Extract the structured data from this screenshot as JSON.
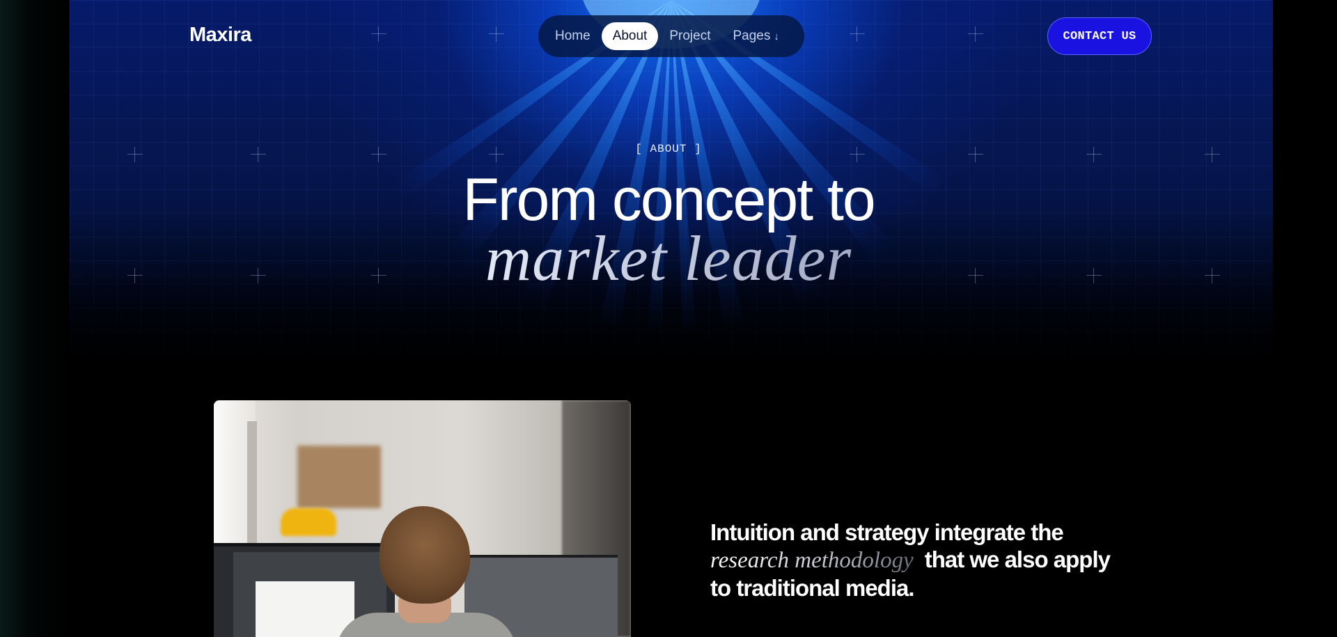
{
  "header": {
    "logo": "Maxira",
    "nav": [
      {
        "label": "Home",
        "active": false
      },
      {
        "label": "About",
        "active": true
      },
      {
        "label": "Project",
        "active": false
      },
      {
        "label": "Pages",
        "active": false,
        "dropdown": true
      }
    ],
    "contact_button": "CONTACT US"
  },
  "hero": {
    "eyebrow": "[ ABOUT ]",
    "title_line1": "From concept to",
    "title_line2": "market leader"
  },
  "statement": {
    "part1": "Intuition and strategy integrate the",
    "italic": "research methodology",
    "part2": "that we also apply to traditional media."
  },
  "colors": {
    "accent_button": "#1a12e0",
    "hero_glow": "#1478ff",
    "background": "#000000"
  },
  "icons": {
    "pages_dropdown": "arrow-down-icon"
  }
}
